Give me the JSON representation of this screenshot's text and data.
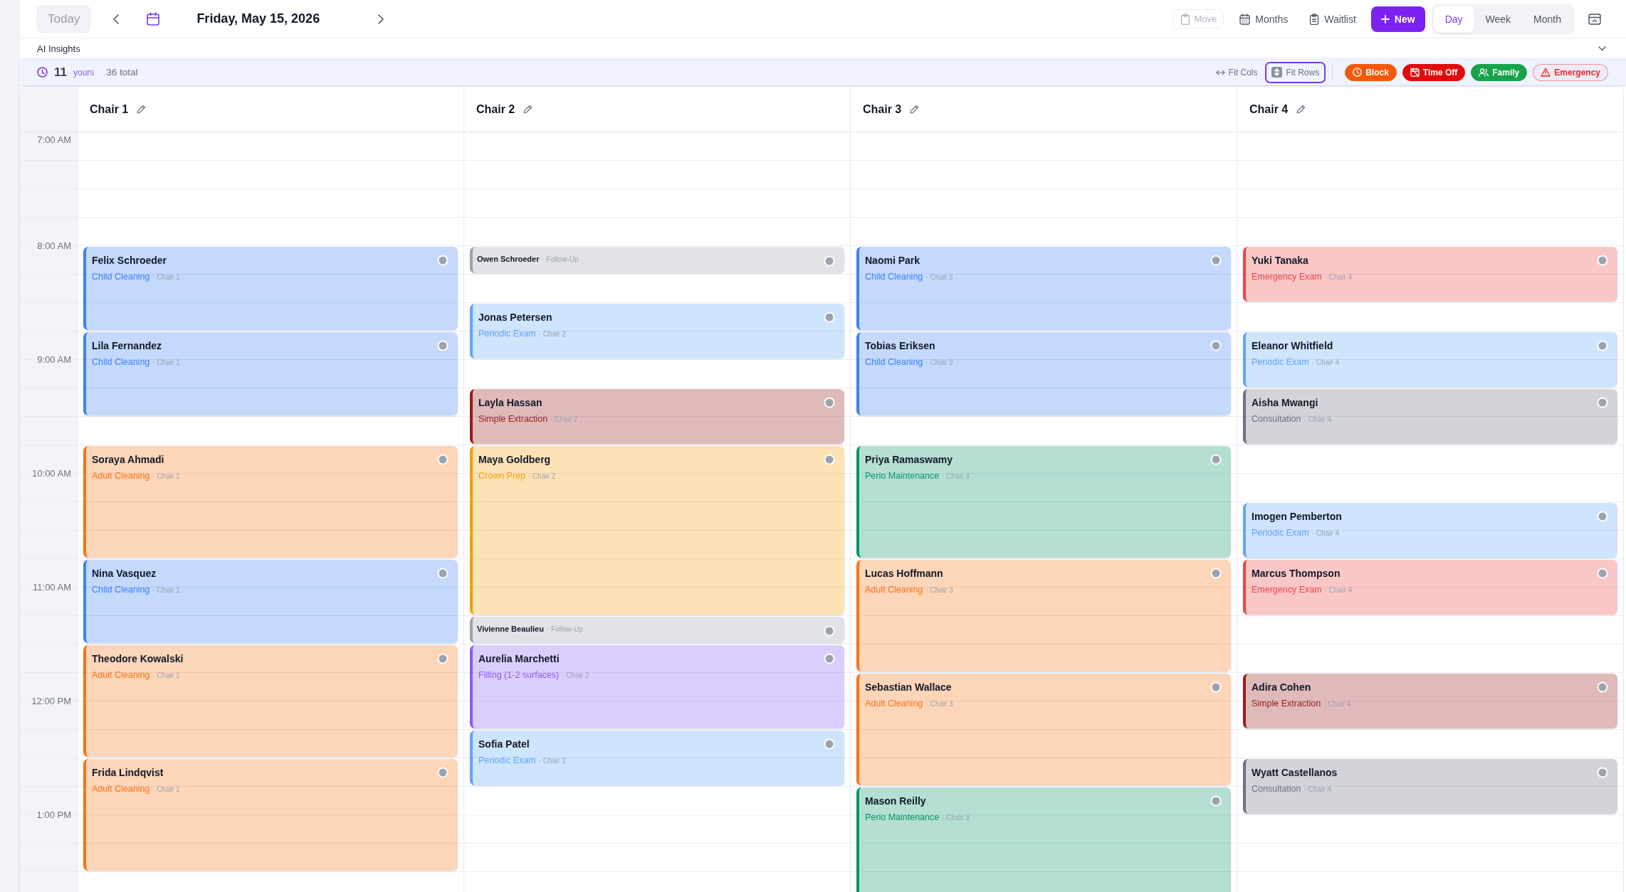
{
  "toolbar": {
    "today_button": "Today",
    "date": "Friday, May 15, 2026",
    "move_button": {
      "label": "Move",
      "disabled": true
    },
    "actions": [
      "Months",
      "Waitlist"
    ],
    "new_button": "New",
    "views": [
      {
        "label": "Day",
        "selected": true
      },
      {
        "label": "Week",
        "selected": false
      },
      {
        "label": "Month",
        "selected": false
      }
    ]
  },
  "insights": {
    "title": "AI Insights",
    "expanded": false
  },
  "stats": {
    "count": "11",
    "count_label": "yours",
    "total": "36 total"
  },
  "fit_options": [
    {
      "label": "Fit Cols",
      "selected": false
    },
    {
      "label": "Fit Rows",
      "selected": true
    }
  ],
  "quick_add": [
    {
      "label": "Block",
      "color": "#f4590b",
      "kind": "filled"
    },
    {
      "label": "Time Off",
      "color": "#e10b0b",
      "kind": "filled"
    },
    {
      "label": "Family",
      "color": "#16a34a",
      "kind": "filled"
    },
    {
      "label": "Emergency",
      "color": "#ef2a2a",
      "kind": "outline"
    }
  ],
  "calendar": {
    "times": [
      "7:00 AM",
      "8:00 AM",
      "9:00 AM",
      "10:00 AM",
      "11:00 AM",
      "12:00 PM",
      "1:00 PM"
    ],
    "columns": [
      {
        "name": "Chair 1",
        "slots": [
          {
            "kind": "free"
          },
          {
            "kind": "free"
          },
          {
            "kind": "free"
          },
          {
            "kind": "free"
          },
          {
            "kind": "medium",
            "patient": "Felix Schroeder",
            "type": "Child Cleaning",
            "chair": "· Chair 1",
            "color": "#3b82f6"
          },
          {
            "kind": "medium",
            "patient": "Lila Fernandez",
            "type": "Child Cleaning",
            "chair": "· Chair 1",
            "color": "#3b82f6"
          },
          {
            "kind": "free"
          },
          {
            "kind": "long",
            "patient": "Soraya Ahmadi",
            "type": "Adult Cleaning",
            "chair": "· Chair 1",
            "color": "#f97316"
          },
          {
            "kind": "medium",
            "patient": "Nina Vasquez",
            "type": "Child Cleaning",
            "chair": "· Chair 1",
            "color": "#3b82f6"
          },
          {
            "kind": "long",
            "patient": "Theodore Kowalski",
            "type": "Adult Cleaning",
            "chair": "· Chair 1",
            "color": "#f97316"
          },
          {
            "kind": "long",
            "patient": "Frida Lindqvist",
            "type": "Adult Cleaning",
            "chair": "· Chair 1",
            "color": "#f97316"
          },
          {
            "kind": "free"
          }
        ]
      },
      {
        "name": "Chair 2",
        "slots": [
          {
            "kind": "free"
          },
          {
            "kind": "free"
          },
          {
            "kind": "free"
          },
          {
            "kind": "free"
          },
          {
            "kind": "brief",
            "patient": "Owen Schroeder",
            "type": "· Follow-Up",
            "color": "#9ca3af"
          },
          {
            "kind": "free"
          },
          {
            "kind": "short",
            "patient": "Jonas Petersen",
            "type": "Periodic Exam",
            "chair": "· Chair 2",
            "color": "#60a5fa"
          },
          {
            "kind": "free"
          },
          {
            "kind": "short",
            "patient": "Layla Hassan",
            "type": "Simple Extraction",
            "chair": "· Chair 2",
            "color": "#991b1b"
          },
          {
            "kind": "extended",
            "patient": "Maya Goldberg",
            "type": "Crown Prep",
            "chair": "· Chair 2",
            "color": "#f59e0b"
          },
          {
            "kind": "brief",
            "patient": "Vivienne Beaulieu",
            "type": "· Follow-Up",
            "color": "#9ca3af"
          },
          {
            "kind": "medium",
            "patient": "Aurelia Marchetti",
            "type": "Filling (1-2 surfaces)",
            "chair": "· Chair 2",
            "color": "#8b5cf6"
          },
          {
            "kind": "short",
            "patient": "Sofia Patel",
            "type": "Periodic Exam",
            "chair": "· Chair 2",
            "color": "#60a5fa"
          },
          {
            "kind": "free"
          },
          {
            "kind": "free"
          },
          {
            "kind": "free"
          },
          {
            "kind": "free"
          }
        ]
      },
      {
        "name": "Chair 3",
        "slots": [
          {
            "kind": "free"
          },
          {
            "kind": "free"
          },
          {
            "kind": "free"
          },
          {
            "kind": "free"
          },
          {
            "kind": "medium",
            "patient": "Naomi Park",
            "type": "Child Cleaning",
            "chair": "· Chair 3",
            "color": "#3b82f6"
          },
          {
            "kind": "medium",
            "patient": "Tobias Eriksen",
            "type": "Child Cleaning",
            "chair": "· Chair 3",
            "color": "#3b82f6"
          },
          {
            "kind": "free"
          },
          {
            "kind": "long",
            "patient": "Priya Ramaswamy",
            "type": "Perio Maintenance",
            "chair": "· Chair 3",
            "color": "#059669"
          },
          {
            "kind": "long",
            "patient": "Lucas Hoffmann",
            "type": "Adult Cleaning",
            "chair": "· Chair 3",
            "color": "#f97316"
          },
          {
            "kind": "long",
            "patient": "Sebastian Wallace",
            "type": "Adult Cleaning",
            "chair": "· Chair 3",
            "color": "#f97316"
          },
          {
            "kind": "long",
            "patient": "Mason Reilly",
            "type": "Perio Maintenance",
            "chair": "· Chair 3",
            "color": "#059669"
          }
        ]
      },
      {
        "name": "Chair 4",
        "slots": [
          {
            "kind": "free"
          },
          {
            "kind": "free"
          },
          {
            "kind": "free"
          },
          {
            "kind": "free"
          },
          {
            "kind": "short",
            "patient": "Yuki Tanaka",
            "type": "Emergency Exam",
            "chair": "· Chair 4",
            "color": "#ef4444"
          },
          {
            "kind": "free"
          },
          {
            "kind": "short",
            "patient": "Eleanor Whitfield",
            "type": "Periodic Exam",
            "chair": "· Chair 4",
            "color": "#60a5fa"
          },
          {
            "kind": "short",
            "patient": "Aisha Mwangi",
            "type": "Consultation",
            "chair": "· Chair 4",
            "color": "#6b7280"
          },
          {
            "kind": "free"
          },
          {
            "kind": "free"
          },
          {
            "kind": "short",
            "patient": "Imogen Pemberton",
            "type": "Periodic Exam",
            "chair": "· Chair 4",
            "color": "#60a5fa"
          },
          {
            "kind": "short",
            "patient": "Marcus Thompson",
            "type": "Emergency Exam",
            "chair": "· Chair 4",
            "color": "#ef4444"
          },
          {
            "kind": "free"
          },
          {
            "kind": "free"
          },
          {
            "kind": "short",
            "patient": "Adira Cohen",
            "type": "Simple Extraction",
            "chair": "· Chair 4",
            "color": "#991b1b"
          },
          {
            "kind": "free"
          },
          {
            "kind": "short",
            "patient": "Wyatt Castellanos",
            "type": "Consultation",
            "chair": "· Chair 4",
            "color": "#6b7280"
          },
          {
            "kind": "free"
          },
          {
            "kind": "free"
          },
          {
            "kind": "free"
          }
        ]
      }
    ]
  }
}
